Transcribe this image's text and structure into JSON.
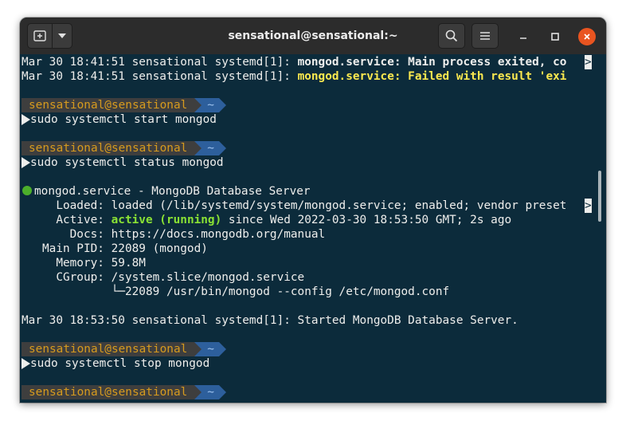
{
  "window": {
    "title": "sensational@sensational:~",
    "colors": {
      "titlebar": "#2c2c2c",
      "terminal_bg": "#0c2b3b",
      "close": "#e95420"
    }
  },
  "titlebar": {
    "new_tab_icon": "new-tab-icon",
    "menu_dropdown_icon": "chevron-down-icon",
    "search_icon": "search-icon",
    "hamburger_icon": "hamburger-menu-icon",
    "minimize_icon": "minimize-icon",
    "maximize_icon": "maximize-icon",
    "close_icon": "close-icon"
  },
  "terminal": {
    "log1_prefix": "Mar 30 18:41:51 sensational systemd[1]: ",
    "log1_msg": "mongod.service: Main process exited, co",
    "log2_prefix": "Mar 30 18:41:51 sensational systemd[1]: ",
    "log2_msg": "mongod.service: Failed with result 'exi",
    "truncate_marker": ">",
    "prompt_user": "sensational@sensational",
    "prompt_dir": "~",
    "cmd_start": "sudo systemctl start mongod",
    "cmd_status": "sudo systemctl status mongod",
    "status_title": "mongod.service - MongoDB Database Server",
    "loaded_label": "     Loaded: ",
    "loaded_value": "loaded (/lib/systemd/system/mongod.service; enabled; vendor preset",
    "active_label": "     Active: ",
    "active_value": "active (running)",
    "active_rest": " since Wed 2022-03-30 18:53:50 GMT; 2s ago",
    "docs_line": "       Docs: https://docs.mongodb.org/manual",
    "pid_line": "   Main PID: 22089 (mongod)",
    "memory_line": "     Memory: 59.8M",
    "cgroup_line": "     CGroup: /system.slice/mongod.service",
    "cgroup_child": "             └─22089 /usr/bin/mongod --config /etc/mongod.conf",
    "started_line": "Mar 30 18:53:50 sensational systemd[1]: Started MongoDB Database Server.",
    "cmd_stop": "sudo systemctl stop mongod"
  }
}
